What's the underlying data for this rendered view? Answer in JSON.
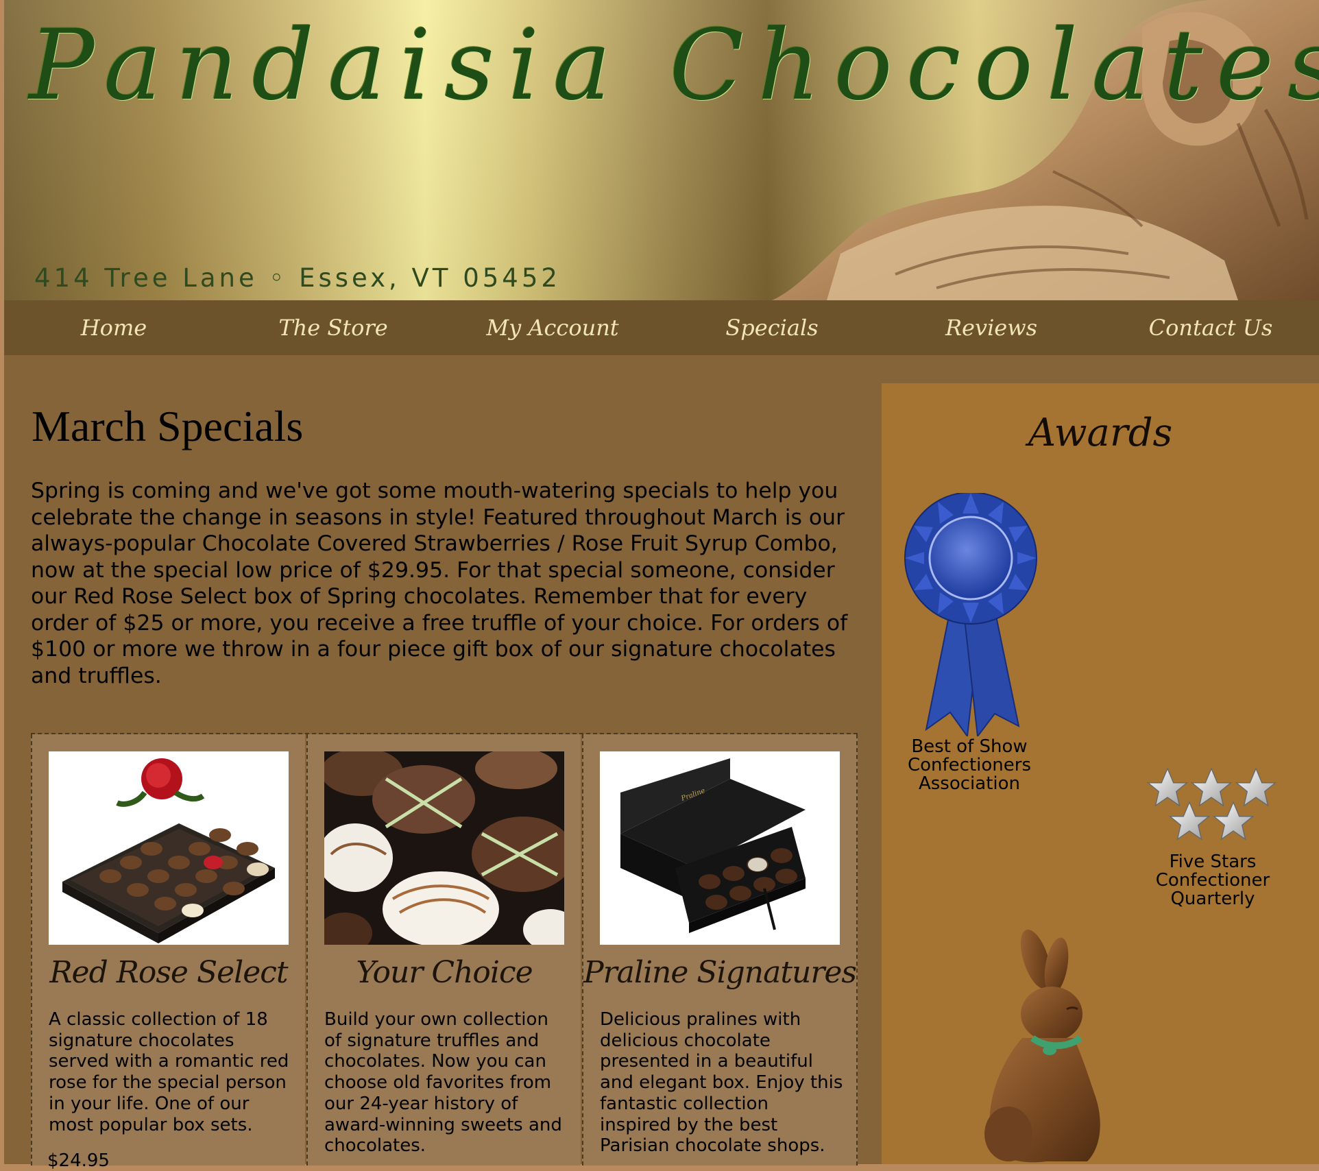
{
  "header": {
    "logo_text": "Pandaisia Chocolates",
    "address": "414 Tree Lane ◦ Essex, VT 05452"
  },
  "nav": [
    {
      "label": "Home"
    },
    {
      "label": "The Store"
    },
    {
      "label": "My Account"
    },
    {
      "label": "Specials"
    },
    {
      "label": "Reviews"
    },
    {
      "label": "Contact Us"
    }
  ],
  "main": {
    "title": "March Specials",
    "intro": "Spring is coming and we've got some mouth-watering specials to help you celebrate the change in seasons in style! Featured throughout March is our always-popular Chocolate Covered Strawberries / Rose Fruit Syrup Combo, now at the special low price of $29.95. For that special someone, consider our Red Rose Select box of Spring chocolates. Remember that for every order of $25 or more, you receive a free truffle of your choice. For orders of $100 or more we throw in a four piece gift box of our signature chocolates and truffles."
  },
  "products": [
    {
      "name": "Red Rose Select",
      "description": "A classic collection of 18 signature chocolates served with a romantic red rose for the special person in your life. One of our most popular box sets.",
      "price": "$24.95"
    },
    {
      "name": "Your Choice",
      "description": "Build your own collection of signature truffles and chocolates. Now you can choose old favorites from our 24-year history of award-winning sweets and chocolates."
    },
    {
      "name": "Praline Signatures",
      "description": "Delicious pralines with delicious chocolate presented in a beautiful and elegant box. Enjoy this fantastic collection inspired by the best Parisian chocolate shops."
    }
  ],
  "sidebar": {
    "title": "Awards",
    "awards": [
      {
        "line1": "Best of Show",
        "line2": "Confectioners",
        "line3": "Association",
        "icon": "blue-ribbon-icon"
      },
      {
        "line1": "Five Stars",
        "line2": "Confectioner",
        "line3": "Quarterly",
        "icon": "five-stars-icon",
        "rating": 5
      }
    ]
  },
  "colors": {
    "nav_bg": "#6d532b",
    "nav_text": "#f2e6b6",
    "main_bg": "#85643a",
    "sidebar_bg": "#a67432",
    "card_bg": "#9a7a55",
    "logo_green": "#1f4d16"
  }
}
